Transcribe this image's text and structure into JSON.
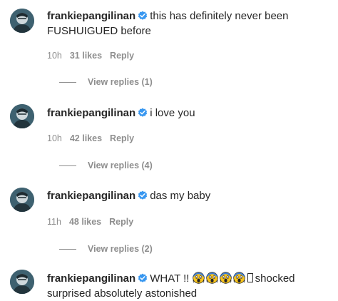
{
  "comments": [
    {
      "username": "frankiepangilinan",
      "text": "this has definitely never been FUSHUIGUED before",
      "time": "10h",
      "likes": "31 likes",
      "reply": "Reply",
      "replies": "View replies (1)"
    },
    {
      "username": "frankiepangilinan",
      "text": "i love you",
      "time": "10h",
      "likes": "42 likes",
      "reply": "Reply",
      "replies": "View replies (4)"
    },
    {
      "username": "frankiepangilinan",
      "text": "das my baby",
      "time": "11h",
      "likes": "48 likes",
      "reply": "Reply",
      "replies": "View replies (2)"
    },
    {
      "username": "frankiepangilinan",
      "text_before": "WHAT !!",
      "emojis": [
        "screaming-face-emoji",
        "screaming-face-emoji",
        "screaming-face-emoji",
        "screaming-face-emoji"
      ],
      "text_after": "shocked surprised absolutely astonished"
    }
  ],
  "colors": {
    "text": "#262626",
    "muted": "#8e8e8e",
    "verified": "#3897f0"
  }
}
